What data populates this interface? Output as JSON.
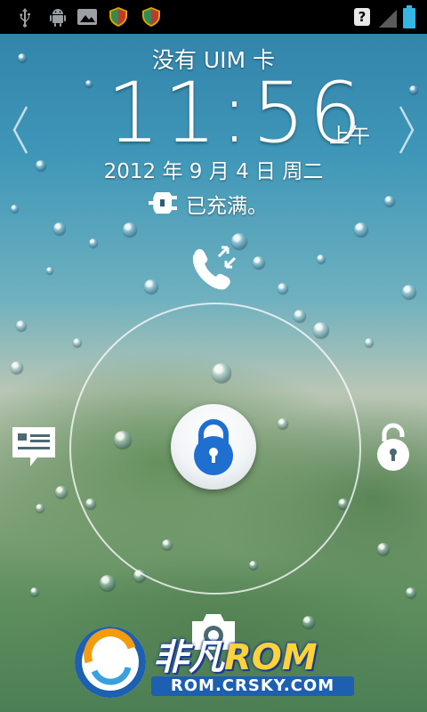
{
  "status_bar": {
    "icons": [
      "usb-icon",
      "android-debug-icon",
      "gallery-icon",
      "shield-icon",
      "shield-icon",
      "no-sim-icon",
      "signal-icon",
      "battery-icon"
    ],
    "unknown_sim_glyph": "?"
  },
  "lockscreen": {
    "sim_status": "没有 UIM 卡",
    "time": "11:56",
    "ampm": "上午",
    "date": "2012 年 9 月 4 日 周二",
    "charge_status": "已充满。",
    "targets": [
      "phone-icon",
      "message-icon",
      "unlock-icon",
      "camera-icon"
    ]
  },
  "watermark": {
    "name_cn": "非凡",
    "name_rom": "ROM",
    "url": "ROM.CRSKY.COM"
  },
  "colors": {
    "accent_blue": "#1f6fd1",
    "battery": "#33b5e5",
    "watermark_yellow": "#ffd23a"
  }
}
